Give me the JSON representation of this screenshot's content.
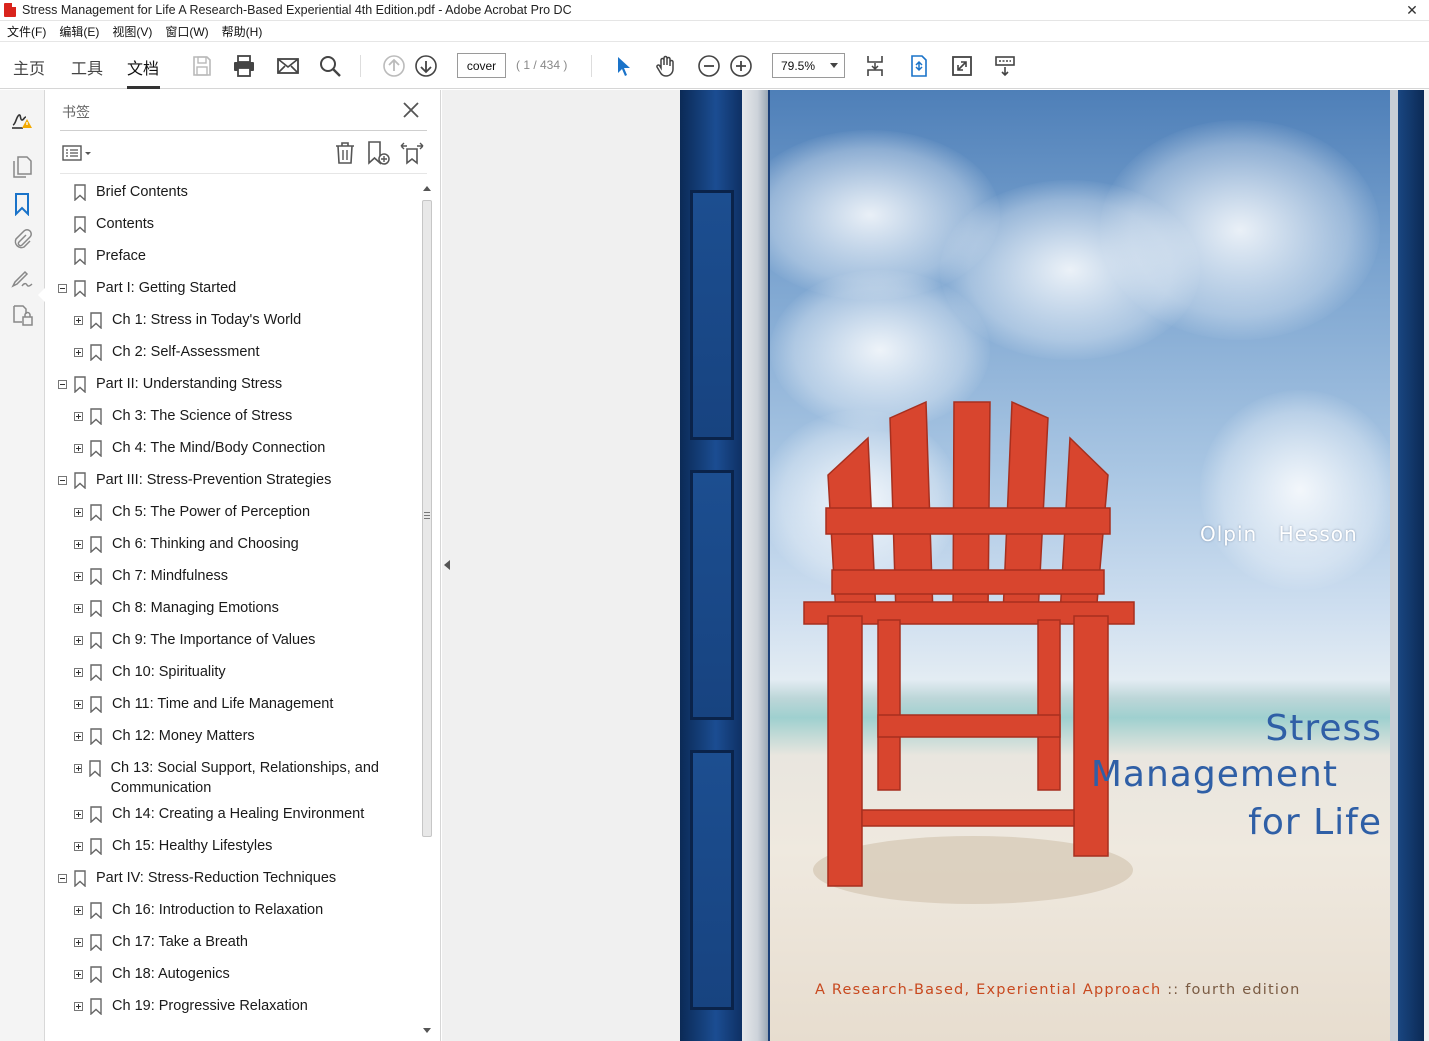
{
  "window": {
    "title": "Stress Management for Life A Research-Based Experiential 4th Edition.pdf - Adobe Acrobat Pro DC"
  },
  "menubar": {
    "items": [
      "文件(F)",
      "编辑(E)",
      "视图(V)",
      "窗口(W)",
      "帮助(H)"
    ]
  },
  "toolbar": {
    "tabs": [
      "主页",
      "工具",
      "文档"
    ],
    "active_tab": "文档",
    "page_input": "cover",
    "page_count": "( 1 / 434 )",
    "zoom": "79.5%"
  },
  "bookmarks": {
    "title": "书签",
    "items": [
      {
        "label": "Brief Contents",
        "level": 0,
        "toggle": "none"
      },
      {
        "label": "Contents",
        "level": 0,
        "toggle": "none"
      },
      {
        "label": "Preface",
        "level": 0,
        "toggle": "none"
      },
      {
        "label": "Part I: Getting Started",
        "level": 0,
        "toggle": "minus"
      },
      {
        "label": "Ch 1: Stress in Today's World",
        "level": 1,
        "toggle": "plus"
      },
      {
        "label": "Ch 2: Self-Assessment",
        "level": 1,
        "toggle": "plus"
      },
      {
        "label": "Part II: Understanding Stress",
        "level": 0,
        "toggle": "minus"
      },
      {
        "label": "Ch 3: The Science of Stress",
        "level": 1,
        "toggle": "plus"
      },
      {
        "label": "Ch 4: The Mind/Body Connection",
        "level": 1,
        "toggle": "plus"
      },
      {
        "label": "Part III: Stress-Prevention Strategies",
        "level": 0,
        "toggle": "minus"
      },
      {
        "label": "Ch 5: The Power of Perception",
        "level": 1,
        "toggle": "plus"
      },
      {
        "label": "Ch 6: Thinking and Choosing",
        "level": 1,
        "toggle": "plus"
      },
      {
        "label": "Ch 7: Mindfulness",
        "level": 1,
        "toggle": "plus"
      },
      {
        "label": "Ch 8: Managing Emotions",
        "level": 1,
        "toggle": "plus"
      },
      {
        "label": "Ch 9: The Importance of Values",
        "level": 1,
        "toggle": "plus"
      },
      {
        "label": "Ch 10: Spirituality",
        "level": 1,
        "toggle": "plus"
      },
      {
        "label": "Ch 11: Time and Life Management",
        "level": 1,
        "toggle": "plus"
      },
      {
        "label": "Ch 12: Money Matters",
        "level": 1,
        "toggle": "plus"
      },
      {
        "label": "Ch 13: Social Support, Relationships, and Communication",
        "level": 1,
        "toggle": "plus"
      },
      {
        "label": "Ch 14: Creating a Healing Environment",
        "level": 1,
        "toggle": "plus"
      },
      {
        "label": "Ch 15: Healthy Lifestyles",
        "level": 1,
        "toggle": "plus"
      },
      {
        "label": "Part IV: Stress-Reduction Techniques",
        "level": 0,
        "toggle": "minus"
      },
      {
        "label": "Ch 16: Introduction to Relaxation",
        "level": 1,
        "toggle": "plus"
      },
      {
        "label": "Ch 17: Take a Breath",
        "level": 1,
        "toggle": "plus"
      },
      {
        "label": "Ch 18: Autogenics",
        "level": 1,
        "toggle": "plus"
      },
      {
        "label": "Ch 19: Progressive Relaxation",
        "level": 1,
        "toggle": "plus"
      }
    ]
  },
  "cover": {
    "authors": "Olpin   Hesson",
    "title_line1": "Stress",
    "title_line2": "Management",
    "title_line3": "for Life",
    "subtitle": "A Research-Based, Experiential Approach",
    "separator": "::",
    "edition": "fourth edition"
  },
  "colors": {
    "accent_blue": "#1a73c9",
    "cover_title": "#2f5fa6",
    "cover_subtitle": "#c8491f",
    "chair_red": "#d8452e"
  }
}
